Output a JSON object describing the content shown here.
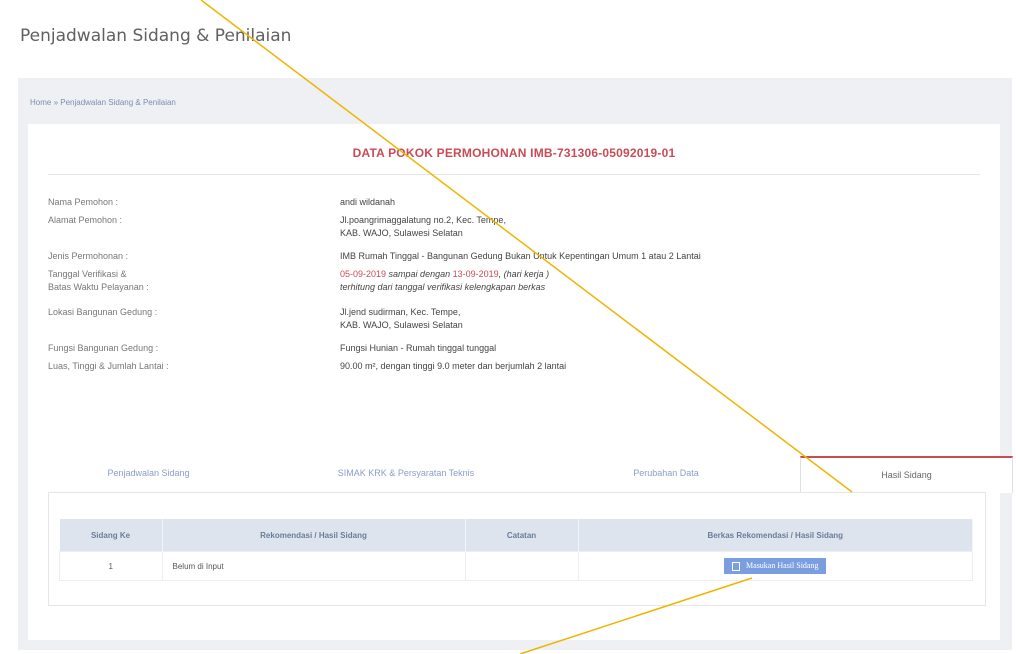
{
  "page_title": "Penjadwalan Sidang & Penilaian",
  "breadcrumb": "Home » Penjadwalan Sidang & Penilaian",
  "card": {
    "title": "DATA POKOK PERMOHONAN IMB-731306-05092019-01",
    "fields": [
      {
        "label": "Nama Pemohon :",
        "value": "andi wildanah"
      },
      {
        "label": "Alamat Pemohon :",
        "value": "Jl.poangrimaggalatung no.2, Kec. Tempe,",
        "value2": "KAB. WAJO, Sulawesi Selatan"
      },
      {
        "label": "Jenis Permohonan :",
        "value": "IMB Rumah Tinggal - Bangunan Gedung Bukan Untuk Kepentingan Umum 1 atau 2 Lantai"
      },
      {
        "label": "Tanggal Verifikasi &",
        "label2": "Batas Waktu Pelayanan :",
        "date_start": "05-09-2019",
        "date_mid": " sampai dengan ",
        "date_end": "13-09-2019",
        "date_tail": ", (hari kerja )",
        "value2": "terhitung dari tanggal verifikasi kelengkapan berkas"
      },
      {
        "label": "Lokasi Bangunan Gedung :",
        "value": "Jl.jend sudirman, Kec. Tempe,",
        "value2": "KAB. WAJO, Sulawesi Selatan"
      },
      {
        "label": "Fungsi Bangunan Gedung :",
        "value": "Fungsi Hunian - Rumah tinggal tunggal"
      },
      {
        "label": "Luas, Tinggi & Jumlah Lantai :",
        "value": "90.00 m², dengan tinggi 9.0 meter dan berjumlah 2 lantai"
      }
    ]
  },
  "tabs": [
    "Penjadwalan Sidang",
    "SIMAK KRK & Persyaratan Teknis",
    "Perubahan Data",
    "Hasil Sidang"
  ],
  "active_tab": "Hasil Sidang",
  "table": {
    "headers": [
      "Sidang Ke",
      "Rekomendasi / Hasil Sidang",
      "Catatan",
      "Berkas Rekomendasi / Hasil Sidang"
    ],
    "rows": [
      {
        "sidang_ke": "1",
        "rekomendasi": "Belum di Input",
        "catatan": "",
        "button": "Masukan Hasil Sidang"
      }
    ]
  },
  "colors": {
    "accent": "#c94b55",
    "button": "#7b9ee0",
    "annotation": "#f0b400"
  }
}
